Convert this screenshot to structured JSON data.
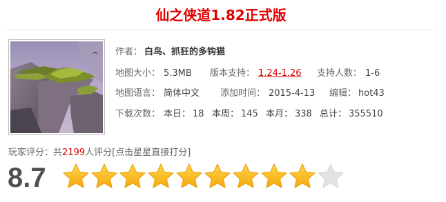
{
  "title": "仙之侠道1.82正式版",
  "author": {
    "label": "作者：",
    "value": "白鸟、抓狂的多钩猫"
  },
  "map_size": {
    "label": "地图大小：",
    "value": "5.3MB"
  },
  "version_support": {
    "label": "版本支持：",
    "value": "1.24-1.26"
  },
  "players": {
    "label": "支持人数：",
    "value": "1-6"
  },
  "language": {
    "label": "地图语言：",
    "value": "简体中文"
  },
  "added": {
    "label": "添加时间：",
    "value": "2015-4-13"
  },
  "editor": {
    "label": "编辑：",
    "value": "hot43"
  },
  "downloads": {
    "label": "下载次数：",
    "today_label": "本日：",
    "today": "18",
    "week_label": "本周：",
    "week": "145",
    "month_label": "本月：",
    "month": "338",
    "total_label": "总计：",
    "total": "355510"
  },
  "rating": {
    "label": "玩家评分：",
    "prefix": "共",
    "count": "2199",
    "suffix": "人评分",
    "hint": "[点击星星直接打分]",
    "score": "8.7",
    "filled_stars": 9,
    "max_stars": 10
  },
  "colors": {
    "title": "#e00000",
    "link": "#d40000",
    "star_fill": "#f5a90c",
    "star_empty": "#e3e3e3"
  }
}
